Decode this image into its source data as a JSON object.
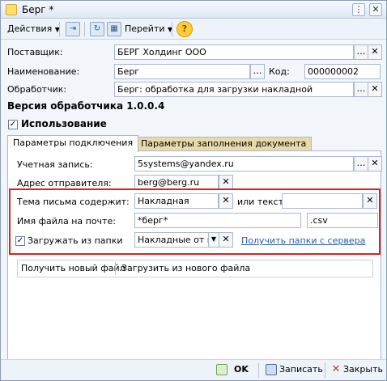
{
  "window": {
    "title": "Берг *"
  },
  "toolbar": {
    "actions_label": "Действия",
    "goto_label": "Перейти"
  },
  "form": {
    "supplier_label": "Поставщик:",
    "supplier_value": "БЕРГ Холдинг ООО",
    "name_label": "Наименование:",
    "name_value": "Берг",
    "code_label": "Код:",
    "code_value": "000000002",
    "handler_label": "Обработчик:",
    "handler_value": "Берг: обработка для загрузки накладной",
    "version_label": "Версия обработчика 1.0.0.4",
    "usage_label": "Использование",
    "usage_checked": true
  },
  "tabs": [
    {
      "label": "Параметры подключения",
      "active": true
    },
    {
      "label": "Параметры заполнения документа",
      "active": false
    }
  ],
  "connection": {
    "account_label": "Учетная запись:",
    "account_value": "5systems@yandex.ru",
    "sender_label": "Адрес отправителя:",
    "sender_value": "berg@berg.ru",
    "subject_label": "Тема письма содержит:",
    "subject_value": "Накладная",
    "or_text_label": "или текст:",
    "or_text_value": "",
    "filename_label": "Имя файла на почте:",
    "filename_value": "*берг*",
    "extension_value": ".csv",
    "load_folder_label": "Загружать из папки",
    "load_folder_checked": true,
    "folder_value": "Накладные от по",
    "get_folders_link": "Получить папки с сервера",
    "get_new_file": "Получить новый файл",
    "load_new_file": "Загрузить из нового файла"
  },
  "footer": {
    "ok_label": "OK",
    "save_label": "Записать",
    "close_label": "Закрыть"
  }
}
